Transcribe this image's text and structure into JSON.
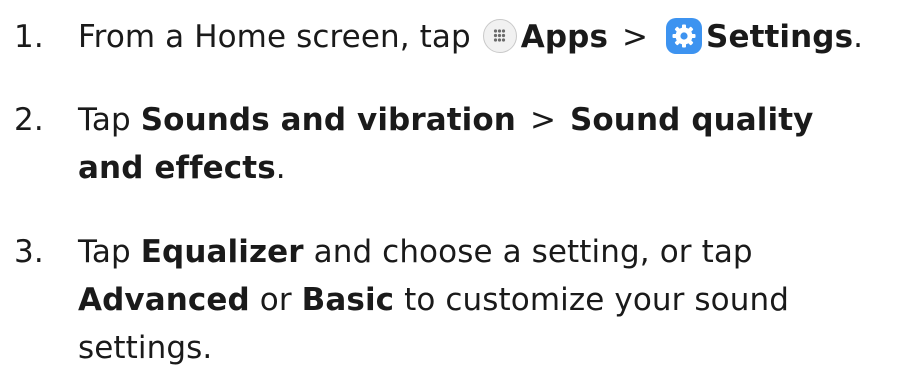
{
  "steps": [
    {
      "number": "1.",
      "prefix": "From a Home screen, tap",
      "apps_label": "Apps",
      "separator": ">",
      "settings_label": "Settings",
      "suffix": ".",
      "apps_icon": "apps-grid-icon",
      "settings_icon": "settings-gear-icon"
    },
    {
      "number": "2.",
      "prefix": "Tap",
      "bold_1": "Sounds and vibration",
      "separator": ">",
      "bold_2_line1": "Sound quality",
      "bold_2_line2": "and effects",
      "suffix": "."
    },
    {
      "number": "3.",
      "prefix": "Tap",
      "bold_1": "Equalizer",
      "mid_1": "and choose a setting, or tap",
      "bold_2": "Advanced",
      "mid_2": "or",
      "bold_3": "Basic",
      "mid_3": "to customize your sound",
      "end_line": "settings."
    }
  ],
  "colors": {
    "text": "#1a1a1a",
    "settings_icon_bg": "#3d93f0",
    "apps_icon_bg": "#f1f1f1"
  }
}
